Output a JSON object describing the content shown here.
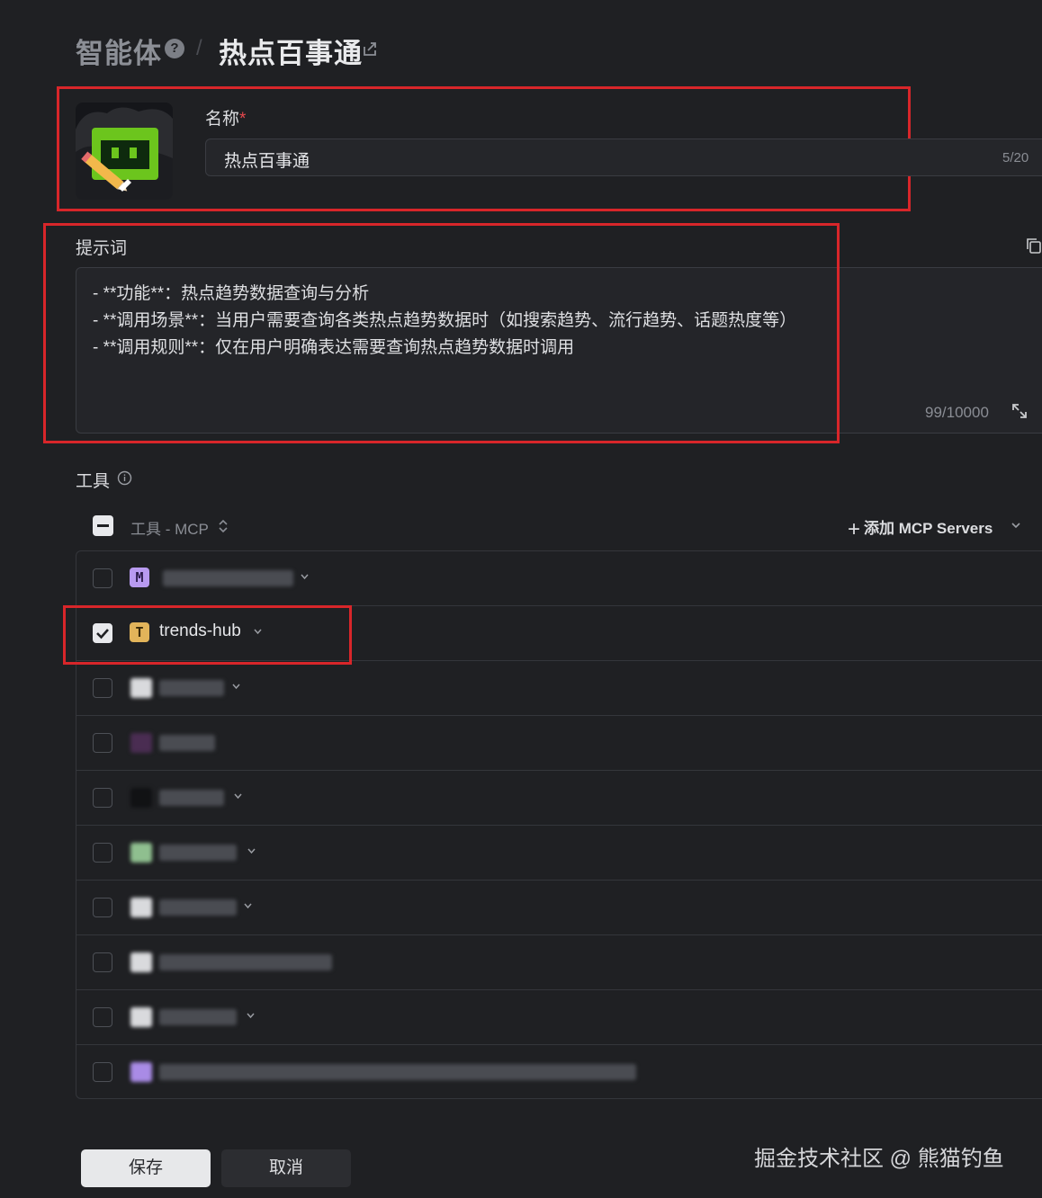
{
  "header": {
    "parent": "智能体",
    "separator": "/",
    "current": "热点百事通"
  },
  "name_field": {
    "label": "名称",
    "required_mark": "*",
    "value": "热点百事通",
    "counter": "5/20"
  },
  "prompt": {
    "label": "提示词",
    "lines": [
      "- **功能**：热点趋势数据查询与分析",
      "- **调用场景**：当用户需要查询各类热点趋势数据时（如搜索趋势、流行趋势、话题热度等）",
      "- **调用规则**：仅在用户明确表达需要查询热点趋势数据时调用"
    ],
    "counter": "99/10000"
  },
  "tools": {
    "title": "工具",
    "group_label": "工具 - MCP",
    "add_button": "添加 MCP Servers",
    "items": [
      {
        "badge": "M",
        "name": "",
        "checked": false,
        "badge_color": "#b89af0"
      },
      {
        "badge": "T",
        "name": "trends-hub",
        "checked": true,
        "badge_color": "#e2b45a"
      },
      {
        "badge": "",
        "name": "",
        "checked": false,
        "badge_color": "#d9dadd"
      },
      {
        "badge": "",
        "name": "",
        "checked": false,
        "badge_color": "#4a2d52"
      },
      {
        "badge": "",
        "name": "",
        "checked": false,
        "badge_color": "#111214"
      },
      {
        "badge": "",
        "name": "",
        "checked": false,
        "badge_color": "#8fbf8f"
      },
      {
        "badge": "",
        "name": "",
        "checked": false,
        "badge_color": "#d9dadd"
      },
      {
        "badge": "",
        "name": "",
        "checked": false,
        "badge_color": "#d9dadd"
      },
      {
        "badge": "",
        "name": "",
        "checked": false,
        "badge_color": "#d9dadd"
      },
      {
        "badge": "",
        "name": "",
        "checked": false,
        "badge_color": "#a98be6"
      }
    ]
  },
  "footer": {
    "save": "保存",
    "cancel": "取消"
  },
  "watermark": "掘金技术社区 @ 熊猫钓鱼",
  "colors": {
    "background": "#1f2023",
    "annotation_red": "#d8262a",
    "required": "#e5484d"
  },
  "icons": [
    "help-icon",
    "share-icon",
    "copy-icon",
    "expand-icon",
    "info-icon",
    "sort-icon",
    "plus-icon",
    "chevron-down-icon",
    "checkmark-icon"
  ]
}
